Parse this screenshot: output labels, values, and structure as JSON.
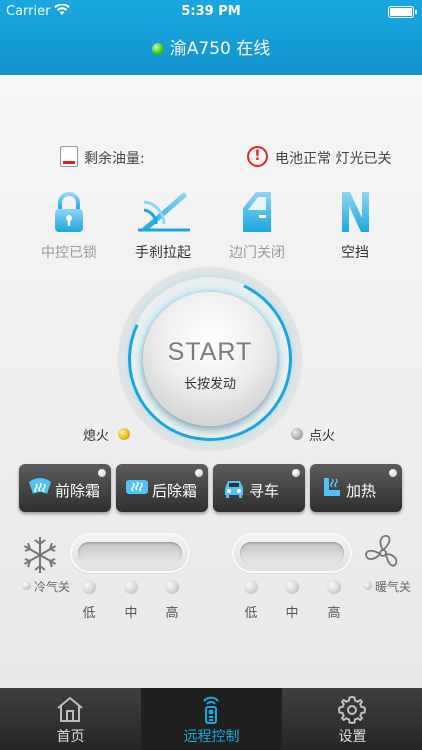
{
  "statusbar": {
    "carrier": "Carrier",
    "time": "5:39 PM"
  },
  "header": {
    "title": "渝A750 在线",
    "online_color": "#3fc21a"
  },
  "info": {
    "fuel_label": "剩余油量:",
    "vehicle_status": "电池正常 灯光已关"
  },
  "states": [
    {
      "label": "中控已锁",
      "icon": "lock-icon",
      "active": false
    },
    {
      "label": "手刹拉起",
      "icon": "handbrake-icon",
      "active": true
    },
    {
      "label": "边门关闭",
      "icon": "door-icon",
      "active": false
    },
    {
      "label": "空挡",
      "icon": "neutral-gear-icon",
      "active": true
    }
  ],
  "start": {
    "title": "START",
    "subtitle": "长按发动"
  },
  "ignition": {
    "off_label": "熄火",
    "on_label": "点火",
    "current": "熄火"
  },
  "controls": [
    {
      "label": "前除霜",
      "icon": "front-defrost-icon"
    },
    {
      "label": "后除霜",
      "icon": "rear-defrost-icon"
    },
    {
      "label": "寻车",
      "icon": "find-car-icon"
    },
    {
      "label": "加热",
      "icon": "seat-heat-icon"
    }
  ],
  "ac": {
    "cool_label": "冷气关",
    "warm_label": "暖气关",
    "levels": [
      "低",
      "中",
      "高"
    ]
  },
  "tabs": [
    {
      "label": "首页",
      "icon": "home-icon",
      "active": false
    },
    {
      "label": "远程控制",
      "icon": "remote-control-icon",
      "active": true
    },
    {
      "label": "设置",
      "icon": "gear-icon",
      "active": false
    }
  ],
  "colors": {
    "accent": "#1aa7e0",
    "warning": "#e0282a",
    "active_tab": "#1aa7e0"
  }
}
